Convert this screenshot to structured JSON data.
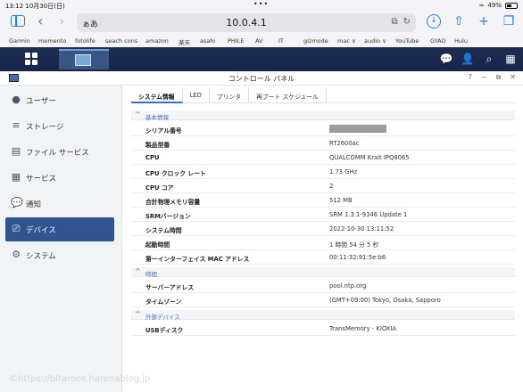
{
  "status_bar": {
    "time": "13:12  10月30日(日)",
    "dots": "•••",
    "battery_pct": "49%"
  },
  "safari": {
    "aa": "ぁあ",
    "url": "10.0.4.1"
  },
  "bookmarks": [
    "Garmin",
    "memento",
    "fotolife",
    "seach cons",
    "amazon",
    "楽天",
    "asahi",
    "PHILE",
    "AV",
    "IT",
    "gizmode",
    "mac ∨",
    "audio ∨",
    "YouTube",
    "GYAO",
    "Hulu"
  ],
  "window": {
    "title": "コントロール パネル"
  },
  "sidebar": {
    "items": [
      {
        "label": "ユーザー",
        "icon": "user-icon"
      },
      {
        "label": "ストレージ",
        "icon": "storage-icon"
      },
      {
        "label": "ファイル サービス",
        "icon": "file-services-icon"
      },
      {
        "label": "サービス",
        "icon": "services-icon"
      },
      {
        "label": "通知",
        "icon": "notification-icon"
      },
      {
        "label": "デバイス",
        "icon": "device-icon"
      },
      {
        "label": "システム",
        "icon": "system-icon"
      }
    ],
    "active_index": 5
  },
  "tabs": [
    "システム情報",
    "LED",
    "プリンタ",
    "再ブート スケジュール"
  ],
  "sections": {
    "basic": "基本情報",
    "time": "時間",
    "external": "外部デバイス"
  },
  "rows": {
    "serial": {
      "key": "シリアル番号",
      "val": ""
    },
    "model": {
      "key": "製品型番",
      "val": "RT2600ac"
    },
    "cpu": {
      "key": "CPU",
      "val": "QUALCOMM Krait IPQ8065"
    },
    "clock": {
      "key": "CPU クロック レート",
      "val": "1.73 GHz"
    },
    "cores": {
      "key": "CPU コア",
      "val": "2"
    },
    "memory": {
      "key": "合計物理メモリ容量",
      "val": "512 MB"
    },
    "srm": {
      "key": "SRMバージョン",
      "val": "SRM 1.3.1-9346 Update 1"
    },
    "systime": {
      "key": "システム時間",
      "val": "2022-10-30 13:11:52"
    },
    "uptime": {
      "key": "起動時間",
      "val": "1 時間 54 分 5 秒"
    },
    "mac": {
      "key": "第一インターフェイス MAC アドレス",
      "val": "00:11:32:91:5e:b6"
    },
    "ntp": {
      "key": "サーバーアドレス",
      "val": "pool.ntp.org"
    },
    "tz": {
      "key": "タイムゾーン",
      "val": "(GMT+09:00) Tokyo, Osaka, Sapporo"
    },
    "usb": {
      "key": "USBディスク",
      "val": "TransMemory - KIOXIA"
    }
  },
  "watermark": "©https://bitaroos.hatenablog.jp"
}
